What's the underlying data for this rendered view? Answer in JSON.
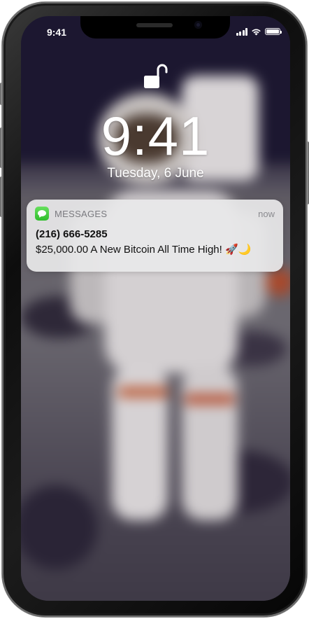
{
  "status_bar": {
    "time": "9:41",
    "signal_icon": "cellular-signal-icon",
    "wifi_icon": "wifi-icon",
    "battery_icon": "battery-icon",
    "battery_level": 1.0
  },
  "lock_screen": {
    "lock_icon": "unlocked-padlock-icon",
    "clock": "9:41",
    "date": "Tuesday, 6 June"
  },
  "notification": {
    "app_icon": "messages-app-icon",
    "app_name": "MESSAGES",
    "time": "now",
    "title": "(216) 666-5285",
    "body": "$25,000.00 A New Bitcoin All Time High! 🚀🌙"
  },
  "colors": {
    "messages_green": "#34c759",
    "notification_bg": "#e8e8ea"
  }
}
